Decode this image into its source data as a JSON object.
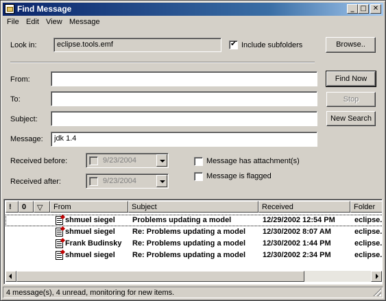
{
  "window": {
    "title": "Find Message",
    "min": "_",
    "max": "□",
    "close": "✕"
  },
  "menu": {
    "file": "File",
    "edit": "Edit",
    "view": "View",
    "message": "Message"
  },
  "look_in": {
    "label": "Look in:",
    "value": "eclipse.tools.emf",
    "include_subfolders": "Include subfolders",
    "include_checked": true,
    "browse": "Browse.."
  },
  "criteria": {
    "from_label": "From:",
    "from_value": "",
    "to_label": "To:",
    "to_value": "",
    "subject_label": "Subject:",
    "subject_value": "",
    "message_label": "Message:",
    "message_value": "jdk 1.4",
    "received_before_label": "Received before:",
    "received_before_value": "9/23/2004",
    "received_after_label": "Received after:",
    "received_after_value": "9/23/2004",
    "has_attachment": "Message has attachment(s)",
    "is_flagged": "Message is flagged"
  },
  "buttons": {
    "find_now": "Find Now",
    "stop": "Stop",
    "new_search": "New Search"
  },
  "results": {
    "columns": {
      "importance": "!",
      "attachment": "0",
      "flag": "▽",
      "from": "From",
      "subject": "Subject",
      "received": "Received",
      "folder": "Folder"
    },
    "rows": [
      {
        "from": "shmuel siegel",
        "subject": "Problems updating a model",
        "received": "12/29/2002 12:54 PM",
        "folder": "eclipse."
      },
      {
        "from": "shmuel siegel",
        "subject": "Re: Problems updating a model",
        "received": "12/30/2002 8:07 AM",
        "folder": "eclipse."
      },
      {
        "from": "Frank Budinsky",
        "subject": "Re: Problems updating a model",
        "received": "12/30/2002 1:44 PM",
        "folder": "eclipse."
      },
      {
        "from": "shmuel siegel",
        "subject": "Re: Problems updating a model",
        "received": "12/30/2002 2:34 PM",
        "folder": "eclipse."
      }
    ]
  },
  "status": "4 message(s), 4 unread, monitoring for new items."
}
